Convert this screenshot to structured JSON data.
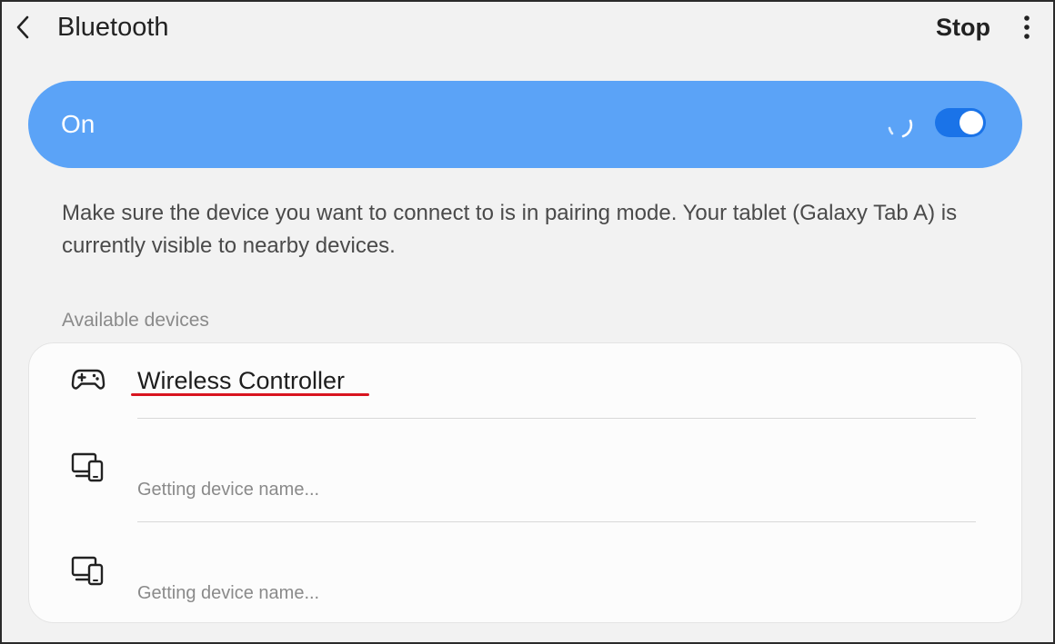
{
  "header": {
    "title": "Bluetooth",
    "back_icon": "chevron-left-icon",
    "stop_label": "Stop",
    "more_icon": "more-vertical-icon"
  },
  "bluetooth": {
    "status_label": "On",
    "enabled": true,
    "scanning": true
  },
  "info": {
    "text": "Make sure the device you want to connect to is in pairing mode. Your tablet (Galaxy Tab A) is currently visible to nearby devices."
  },
  "available_devices": {
    "section_label": "Available devices",
    "items": [
      {
        "name": "Wireless Controller",
        "icon": "gamepad-icon"
      },
      {
        "name": "Getting device name...",
        "icon": "devices-icon"
      },
      {
        "name": "Getting device name...",
        "icon": "devices-icon"
      }
    ]
  },
  "colors": {
    "background": "#f2f2f2",
    "on_bar": "#5ba3f7",
    "toggle_track": "#1a73e8",
    "highlight_underline": "#d8141f"
  }
}
